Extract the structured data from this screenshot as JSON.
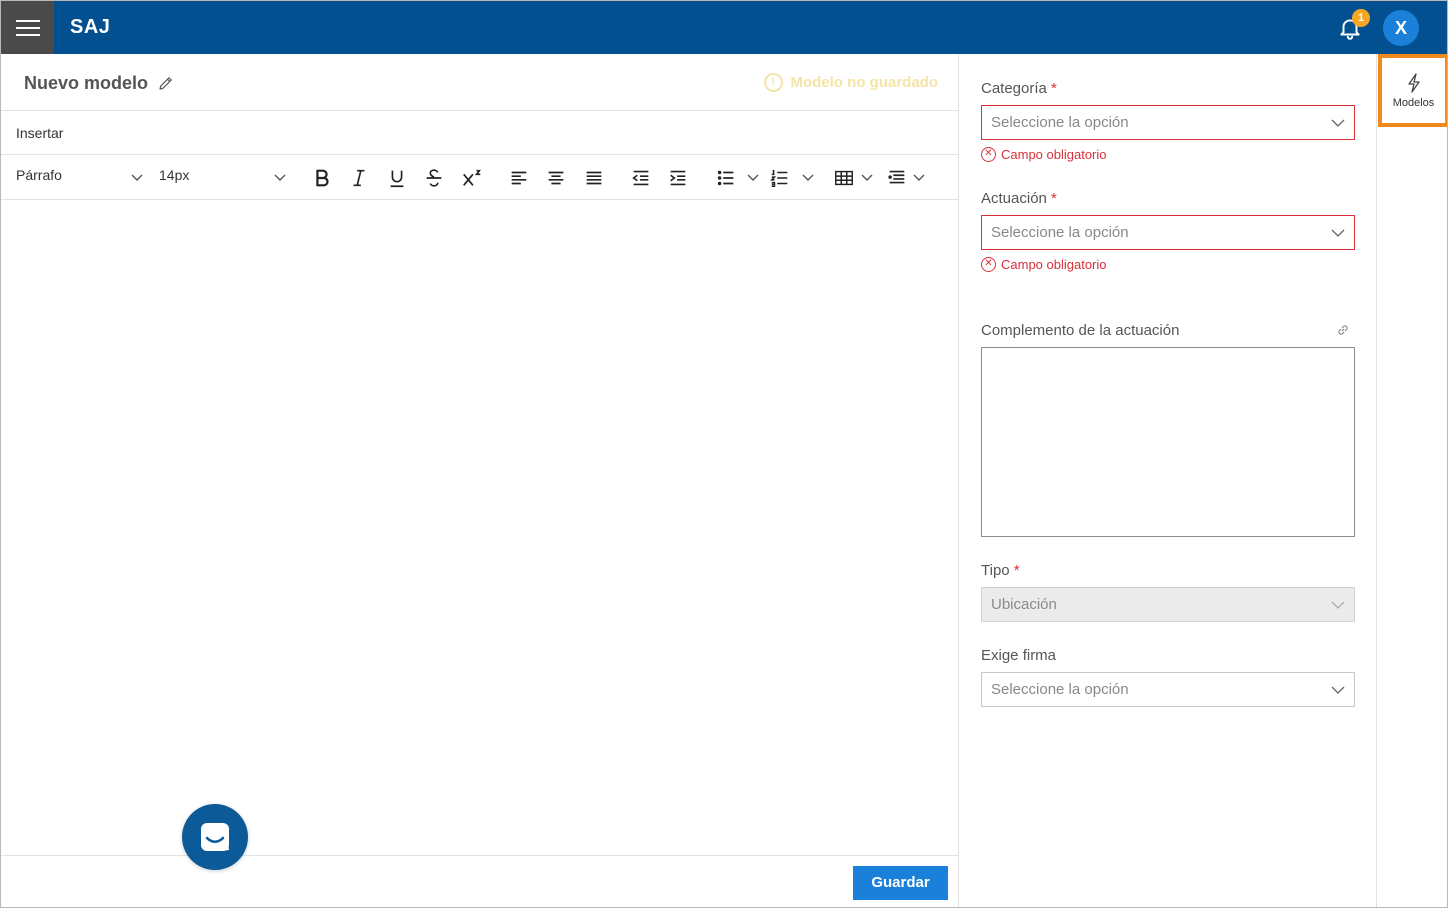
{
  "app": {
    "brand": "SAJ",
    "notifications_count": "1",
    "avatar_initial": "X"
  },
  "editor": {
    "title": "Nuevo modelo",
    "status": "Modelo no guardado",
    "menu": {
      "insert_label": "Insertar"
    },
    "toolbar": {
      "paragraph_style": "Párrafo",
      "font_size": "14px",
      "buttons": [
        "bold",
        "italic",
        "underline",
        "strikethrough",
        "superscript",
        "align-left",
        "align-center",
        "align-justify",
        "outdent",
        "indent",
        "bullet-list",
        "numbered-list",
        "table",
        "line-height"
      ]
    },
    "save_label": "Guardar"
  },
  "form": {
    "categoria": {
      "label": "Categoría",
      "required_mark": "*",
      "placeholder": "Seleccione la opción",
      "error": "Campo obligatorio"
    },
    "actuacion": {
      "label": "Actuación",
      "required_mark": "*",
      "placeholder": "Seleccione la opción",
      "error": "Campo obligatorio"
    },
    "complemento": {
      "label": "Complemento de la actuación",
      "value": ""
    },
    "tipo": {
      "label": "Tipo",
      "required_mark": "*",
      "value": "Ubicación"
    },
    "exige_firma": {
      "label": "Exige firma",
      "placeholder": "Seleccione la opción"
    }
  },
  "sidebar": {
    "models_label": "Modelos"
  },
  "colors": {
    "topbar": "#02508f",
    "accent": "#1a80d9",
    "error": "#d9303a",
    "warning": "#f4e4a6",
    "highlight": "#f28a1b"
  }
}
